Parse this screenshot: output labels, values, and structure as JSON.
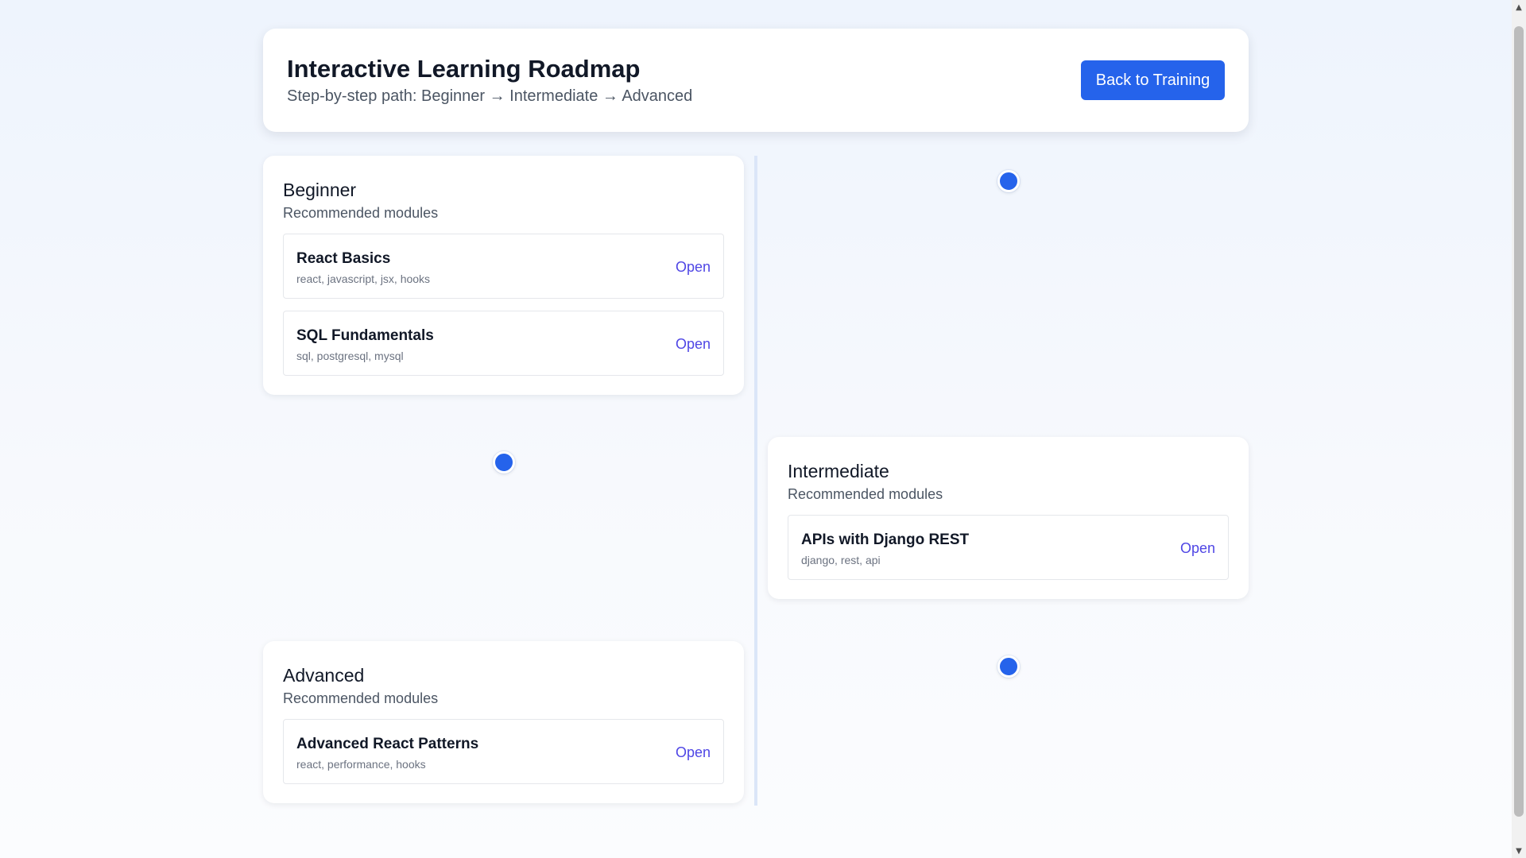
{
  "header": {
    "title": "Interactive Learning Roadmap",
    "subtitle": "Step-by-step path: Beginner → Intermediate → Advanced",
    "back_button_label": "Back to Training"
  },
  "stages": [
    {
      "title": "Beginner",
      "subtitle": "Recommended modules",
      "modules": [
        {
          "title": "React Basics",
          "tags": "react, javascript, jsx, hooks",
          "action": "Open"
        },
        {
          "title": "SQL Fundamentals",
          "tags": "sql, postgresql, mysql",
          "action": "Open"
        }
      ]
    },
    {
      "title": "Intermediate",
      "subtitle": "Recommended modules",
      "modules": [
        {
          "title": "APIs with Django REST",
          "tags": "django, rest, api",
          "action": "Open"
        }
      ]
    },
    {
      "title": "Advanced",
      "subtitle": "Recommended modules",
      "modules": [
        {
          "title": "Advanced React Patterns",
          "tags": "react, performance, hooks",
          "action": "Open"
        }
      ]
    }
  ],
  "colors": {
    "accent": "#2563eb",
    "link": "#4f46e5",
    "background": "#eef4fd",
    "card": "#ffffff"
  },
  "icons": {
    "scroll_up": "scroll-up-arrow-icon",
    "scroll_down": "scroll-down-arrow-icon",
    "timeline_marker": "timeline-dot-icon"
  }
}
